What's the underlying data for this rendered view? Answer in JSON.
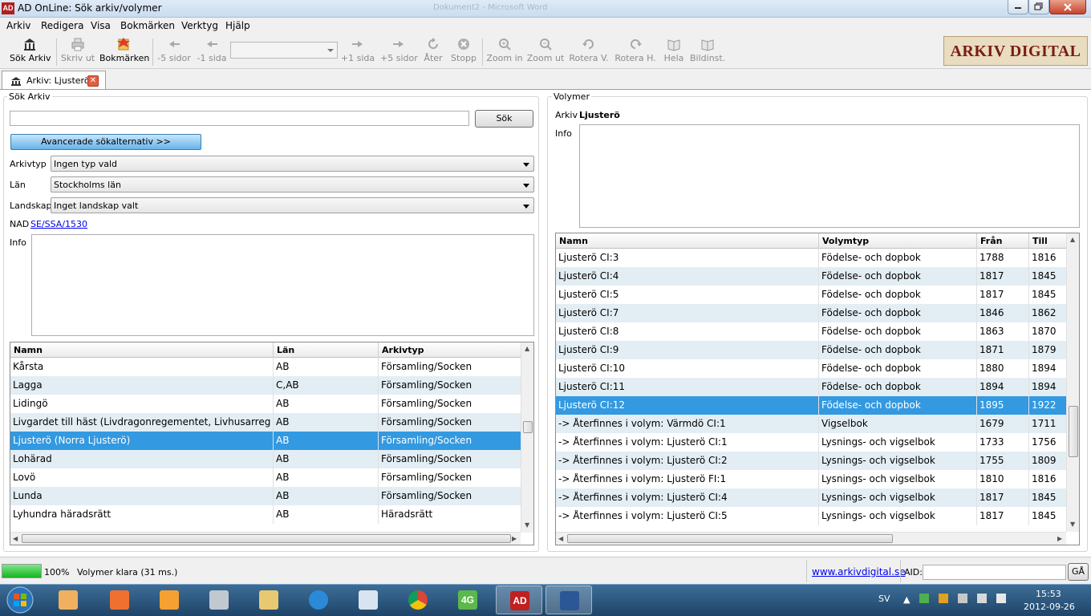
{
  "window": {
    "title": "AD OnLine: Sök arkiv/volymer",
    "icon_text": "AD",
    "background_title": "Dokument2 - Microsoft Word"
  },
  "menu": [
    "Arkiv",
    "Redigera",
    "Visa",
    "Bokmärken",
    "Verktyg",
    "Hjälp"
  ],
  "toolbar": {
    "sok_arkiv": "Sök Arkiv",
    "skriv_ut": "Skriv ut",
    "bokmarken": "Bokmärken",
    "minus5": "-5 sidor",
    "minus1": "-1 sida",
    "plus1": "+1 sida",
    "plus5": "+5 sidor",
    "ater": "Åter",
    "stopp": "Stopp",
    "zoom_in": "Zoom in",
    "zoom_ut": "Zoom ut",
    "rotera_v": "Rotera V.",
    "rotera_h": "Rotera H.",
    "hela": "Hela",
    "bildinst": "Bildinst.",
    "page_select_value": ""
  },
  "logo": "ARKIV DIGITAL",
  "tab": {
    "label": "Arkiv: Ljusterö"
  },
  "search": {
    "group_title": "Sök Arkiv",
    "query": "",
    "sok_button": "Sök",
    "advanced_button": "Avancerade sökalternativ >>",
    "arkivtyp_label": "Arkivtyp",
    "arkivtyp_value": "Ingen typ vald",
    "lan_label": "Län",
    "lan_value": "Stockholms län",
    "landskap_label": "Landskap",
    "landskap_value": "Inget landskap valt",
    "nad_label": "NAD",
    "nad_value": "SE/SSA/1530",
    "info_label": "Info",
    "info_value": ""
  },
  "archives": {
    "columns": [
      "Namn",
      "Län",
      "Arkivtyp"
    ],
    "rows": [
      [
        "Kårsta",
        "AB",
        "Församling/Socken"
      ],
      [
        "Lagga",
        "C,AB",
        "Församling/Socken"
      ],
      [
        "Lidingö",
        "AB",
        "Församling/Socken"
      ],
      [
        "Livgardet till häst (Livdragonregementet, Livhusarregemen...",
        "AB",
        "Församling/Socken"
      ],
      [
        "Ljusterö (Norra Ljusterö)",
        "AB",
        "Församling/Socken"
      ],
      [
        "Lohärad",
        "AB",
        "Församling/Socken"
      ],
      [
        "Lovö",
        "AB",
        "Församling/Socken"
      ],
      [
        "Lunda",
        "AB",
        "Församling/Socken"
      ],
      [
        "Lyhundra häradsrätt",
        "AB",
        "Häradsrätt"
      ]
    ],
    "selected_index": 4
  },
  "volymer": {
    "group_title": "Volymer",
    "arkiv_label": "Arkiv",
    "arkiv_value": "Ljusterö",
    "info_label": "Info",
    "info_value": "",
    "columns": [
      "Namn",
      "Volymtyp",
      "Från",
      "Till"
    ],
    "rows": [
      [
        "Ljusterö CI:3",
        "Födelse- och dopbok",
        "1788",
        "1816"
      ],
      [
        "Ljusterö CI:4",
        "Födelse- och dopbok",
        "1817",
        "1845"
      ],
      [
        "Ljusterö CI:5",
        "Födelse- och dopbok",
        "1817",
        "1845"
      ],
      [
        "Ljusterö CI:7",
        "Födelse- och dopbok",
        "1846",
        "1862"
      ],
      [
        "Ljusterö CI:8",
        "Födelse- och dopbok",
        "1863",
        "1870"
      ],
      [
        "Ljusterö CI:9",
        "Födelse- och dopbok",
        "1871",
        "1879"
      ],
      [
        "Ljusterö CI:10",
        "Födelse- och dopbok",
        "1880",
        "1894"
      ],
      [
        "Ljusterö CI:11",
        "Födelse- och dopbok",
        "1894",
        "1894"
      ],
      [
        "Ljusterö CI:12",
        "Födelse- och dopbok",
        "1895",
        "1922"
      ],
      [
        "-> Återfinnes i volym: Värmdö CI:1",
        "Vigselbok",
        "1679",
        "1711"
      ],
      [
        "-> Återfinnes i volym: Ljusterö CI:1",
        "Lysnings- och vigselbok",
        "1733",
        "1756"
      ],
      [
        "-> Återfinnes i volym: Ljusterö CI:2",
        "Lysnings- och vigselbok",
        "1755",
        "1809"
      ],
      [
        "-> Återfinnes i volym: Ljusterö FI:1",
        "Lysnings- och vigselbok",
        "1810",
        "1816"
      ],
      [
        "-> Återfinnes i volym: Ljusterö CI:4",
        "Lysnings- och vigselbok",
        "1817",
        "1845"
      ],
      [
        "-> Återfinnes i volym: Ljusterö CI:5",
        "Lysnings- och vigselbok",
        "1817",
        "1845"
      ]
    ],
    "selected_index": 8
  },
  "status": {
    "progress_percent": 100,
    "progress_label": "100%",
    "message": "Volymer klara (31 ms.)",
    "website": "www.arkivdigital.se",
    "aid_label": "AID:",
    "aid_value": "",
    "ga_button": "GÅ"
  },
  "taskbar": {
    "language": "SV",
    "time": "15:53",
    "date": "2012-09-26",
    "badge_4g": "4G",
    "ad_label": "AD"
  },
  "colors": {
    "selection": "#3399e0",
    "alt_row": "#e3eef4",
    "progress": "#14b51f",
    "link": "#0000ee"
  }
}
